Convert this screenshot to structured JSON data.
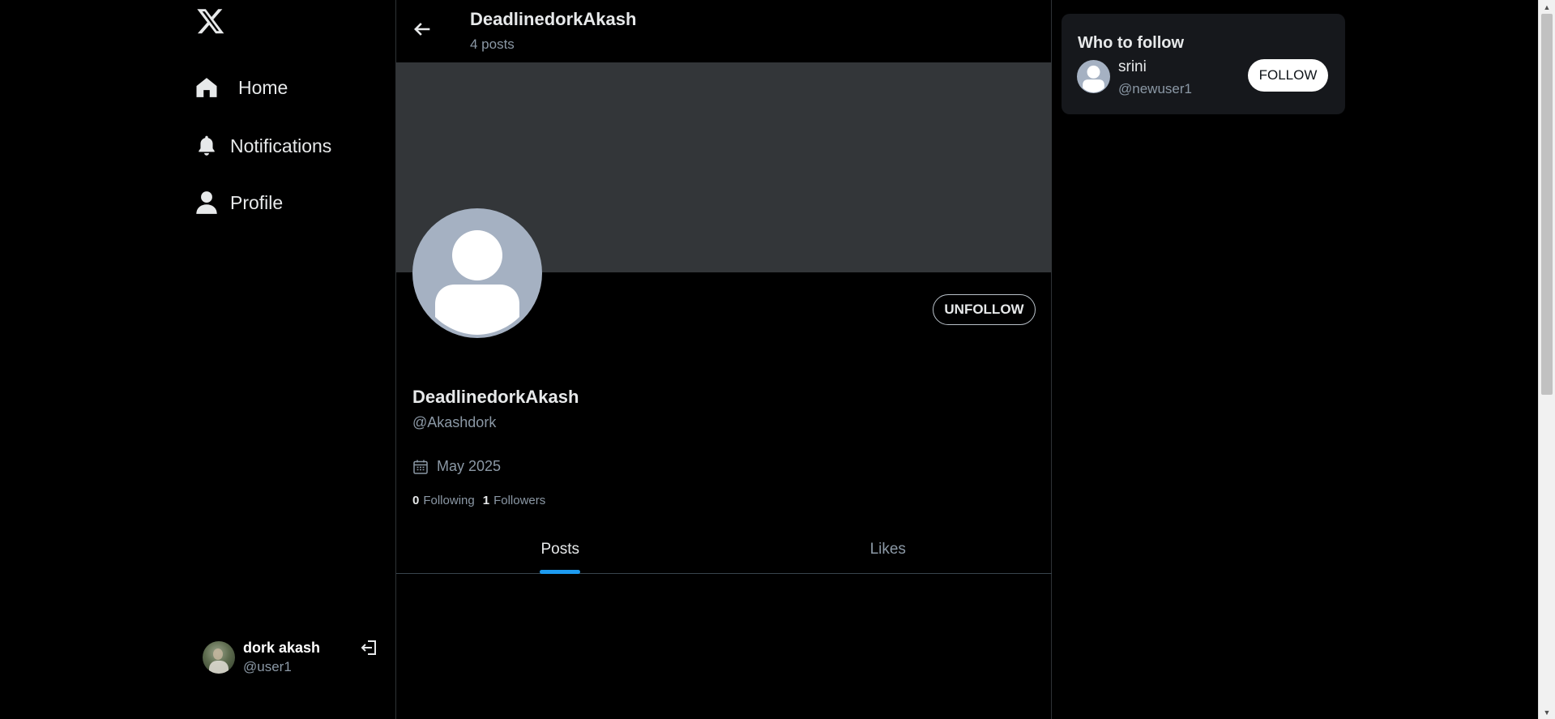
{
  "sidebar": {
    "logo_icon": "x-logo-icon",
    "nav": [
      {
        "label": "Home",
        "icon": "home-icon"
      },
      {
        "label": "Notifications",
        "icon": "bell-icon"
      },
      {
        "label": "Profile",
        "icon": "person-icon"
      }
    ],
    "account": {
      "name": "dork akash",
      "handle": "@user1",
      "logout_icon": "logout-icon"
    }
  },
  "header": {
    "title": "DeadlinedorkAkash",
    "subtitle": "4 posts",
    "back_icon": "arrow-left-icon"
  },
  "profile": {
    "name": "DeadlinedorkAkash",
    "handle": "@Akashdork",
    "joined": "May 2025",
    "following_count": "0",
    "following_label": "Following",
    "followers_count": "1",
    "followers_label": "Followers",
    "unfollow_label": "UNFOLLOW",
    "banner_color": "#333639"
  },
  "tabs": [
    {
      "label": "Posts",
      "active": true
    },
    {
      "label": "Likes",
      "active": false
    }
  ],
  "who_to_follow": {
    "title": "Who to follow",
    "users": [
      {
        "name": "srini",
        "handle": "@newuser1",
        "button": "FOLLOW"
      }
    ]
  },
  "colors": {
    "background": "#000000",
    "accent": "#1d9bf0",
    "muted_text": "#8b98a5",
    "avatar_placeholder": "#a5b1c2",
    "card": "#16181c"
  }
}
